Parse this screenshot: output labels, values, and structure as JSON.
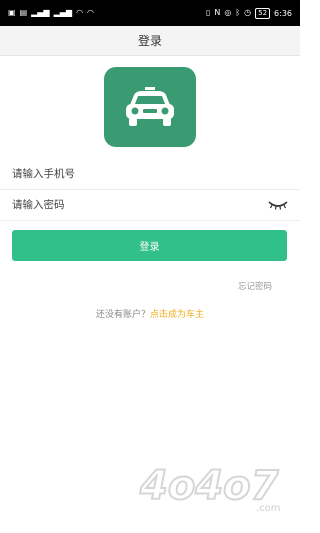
{
  "status_bar": {
    "left_icons": [
      "notification-icon",
      "image-icon",
      "signal-icon",
      "signal-icon",
      "wifi-icon",
      "wifi-icon"
    ],
    "right_icons": [
      "vibrate-icon",
      "nfc-icon",
      "alarm-icon",
      "bluetooth-icon",
      "clock-icon"
    ],
    "battery": "52",
    "time": "6:36"
  },
  "header": {
    "title": "登录"
  },
  "logo": {
    "icon": "taxi-icon",
    "color": "#3a9a72"
  },
  "form": {
    "phone_placeholder": "请输入手机号",
    "password_placeholder": "请输入密码",
    "login_label": "登录",
    "forgot_label": "忘记密码"
  },
  "register": {
    "question": "还没有账户？",
    "link": "点击成为车主"
  },
  "watermark": {
    "text": "4o4o7",
    "subtext": ".com"
  },
  "colors": {
    "accent": "#32c08a",
    "logo_bg": "#3a9a72",
    "link": "#f0ad1c"
  }
}
